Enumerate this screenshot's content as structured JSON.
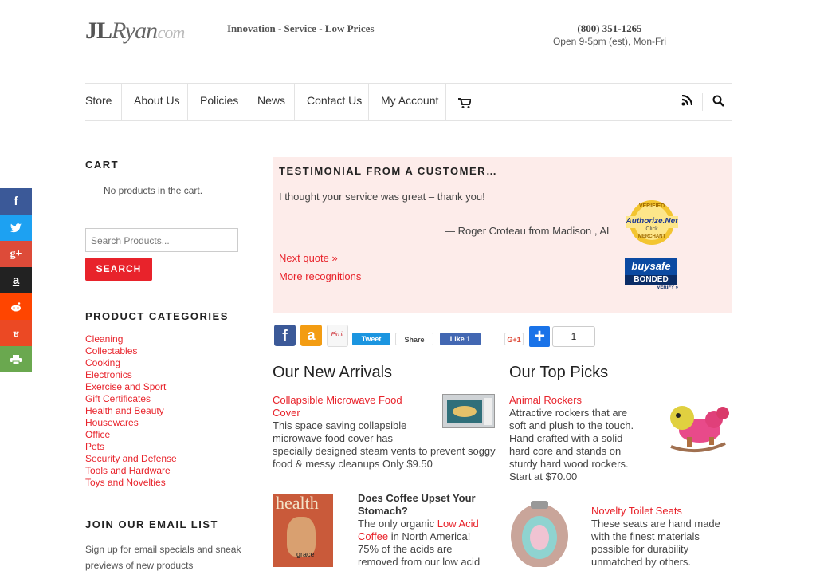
{
  "header": {
    "logo_main": "JL",
    "logo_script": "Ryan",
    "logo_com": ".com",
    "tagline": "Innovation - Service - Low Prices",
    "phone": "(800) 351-1265",
    "hours": "Open 9-5pm (est), Mon-Fri"
  },
  "nav": {
    "items": [
      "Store",
      "About Us",
      "Policies",
      "News",
      "Contact Us",
      "My Account"
    ]
  },
  "social": {
    "buttons": [
      {
        "name": "facebook-icon",
        "glyph": "f",
        "color": "#3b5998"
      },
      {
        "name": "twitter-icon",
        "glyph": "t",
        "color": "#1da1f2"
      },
      {
        "name": "google-plus-icon",
        "glyph": "g+",
        "color": "#dd4b39"
      },
      {
        "name": "amazon-icon",
        "glyph": "a",
        "color": "#222222"
      },
      {
        "name": "reddit-icon",
        "glyph": "r",
        "color": "#ff4500"
      },
      {
        "name": "stumbleupon-icon",
        "glyph": "su",
        "color": "#eb4924"
      },
      {
        "name": "print-icon",
        "glyph": "p",
        "color": "#6aa84f"
      }
    ]
  },
  "sidebar": {
    "cart_title": "CART",
    "cart_empty": "No products in the cart.",
    "search_placeholder": "Search Products...",
    "search_button": "SEARCH",
    "categories_title": "PRODUCT CATEGORIES",
    "categories": [
      "Cleaning",
      "Collectables",
      "Cooking",
      "Electronics",
      "Exercise and Sport",
      "Gift Certificates",
      "Health and Beauty",
      "Housewares",
      "Office",
      "Pets",
      "Security and Defense",
      "Tools and Hardware",
      "Toys and Novelties"
    ],
    "email_title": "JOIN OUR EMAIL LIST",
    "email_text_1": "Sign up for email specials and sneak",
    "email_text_2": "previews of new products"
  },
  "testimonial": {
    "title": "TESTIMONIAL FROM A CUSTOMER…",
    "quote": "I thought your service was great – thank you!",
    "author": "— Roger Croteau from Madison , AL",
    "next_link": "Next quote »",
    "more_link": "More recognitions",
    "authorize_line1": "VERIFIED",
    "authorize_brand": "Authorize.Net",
    "authorize_click": "Click",
    "authorize_line2": "MERCHANT",
    "buysafe_brand": "buysafe",
    "buysafe_bonded": "BONDED",
    "buysafe_verify": "VERIFY »"
  },
  "share": {
    "pinit": "Pin it",
    "tweet": "Tweet",
    "gshare": "Share",
    "like": "Like 1",
    "gplus": "G+1",
    "count": "1"
  },
  "arrivals": {
    "title": "Our New Arrivals",
    "item1_title_1": "Collapsible Microwave Food",
    "item1_title_2": "Cover",
    "item1_desc": [
      "This space saving collapsible",
      "microwave food cover has",
      "specially designed steam vents to prevent soggy",
      "food & messy cleanups Only $9.50"
    ],
    "item2_title_1": "Does Coffee Upset Your",
    "item2_title_2": "Stomach?",
    "item2_l1": "The only organic ",
    "item2_link_a": "Low Acid",
    "item2_link_b": "Coffee",
    "item2_l2_rest": " in North America!",
    "item2_l3": "75% of the acids are",
    "item2_l4": "removed from our low acid",
    "mag_title": "health",
    "mag_sub": "grace"
  },
  "picks": {
    "title": "Our Top Picks",
    "item1_title": "Animal Rockers",
    "item1_desc": [
      "Attractive rockers that are",
      "soft and plush to the touch.",
      "Hand crafted with a solid",
      "hard core and stands on",
      "sturdy hard wood rockers.",
      "Start at $70.00"
    ],
    "item2_title": "Novelty Toilet Seats",
    "item2_desc": [
      "These seats are hand made",
      "with the finest materials",
      "possible for durability",
      "unmatched by others."
    ]
  }
}
